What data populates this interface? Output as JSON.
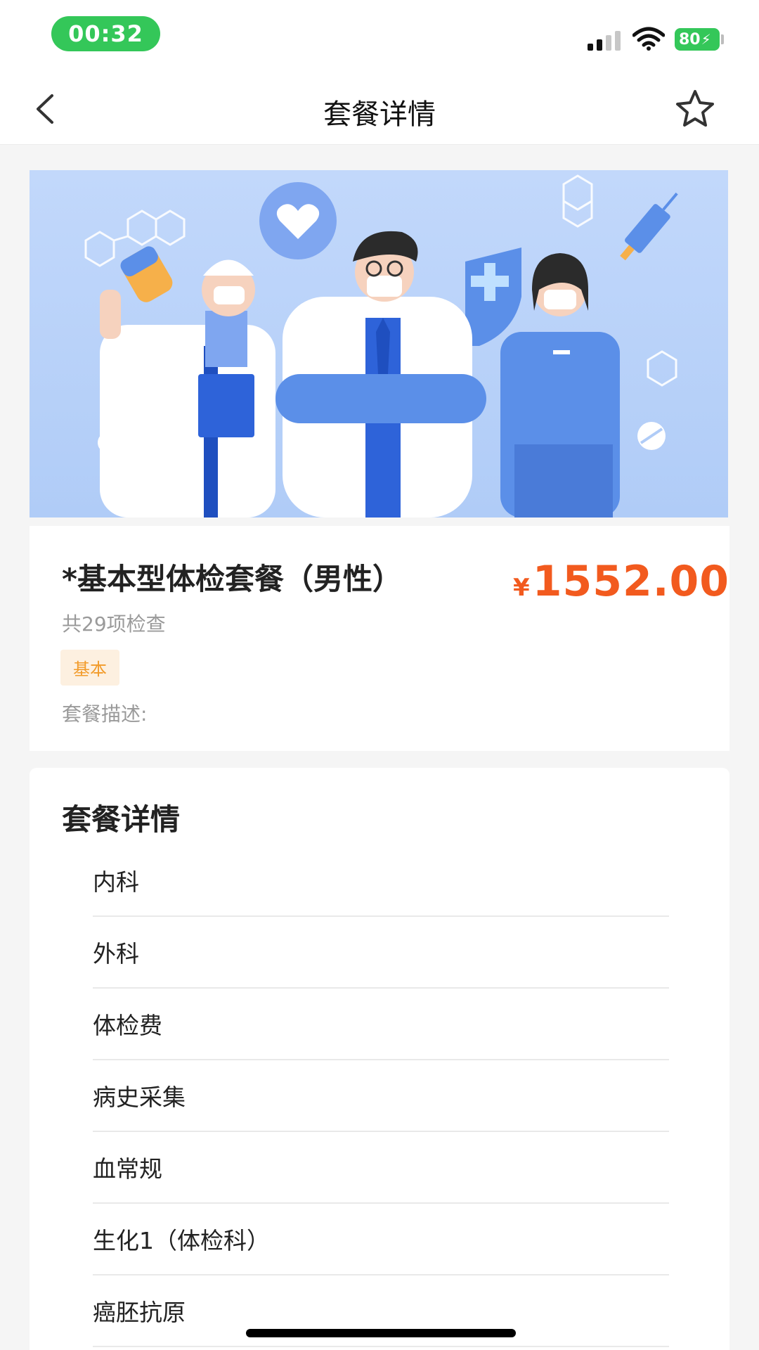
{
  "status_bar": {
    "time": "00:32",
    "battery_level": "80",
    "signal_icon": "signal-icon",
    "wifi_icon": "wifi-icon",
    "battery_icon": "battery-charging-icon",
    "accent_color": "#34c759"
  },
  "nav": {
    "title": "套餐详情",
    "back_icon": "chevron-left-icon",
    "favorite_icon": "star-outline-icon"
  },
  "banner": {
    "image_description_icon": "doctors-illustration",
    "background_color": "#b8d1f8"
  },
  "package": {
    "title": "*基本型体检套餐（男性）",
    "price_symbol": "¥",
    "price": "1552.00",
    "price_color": "#f25a1e",
    "item_count_text": "共29项检查",
    "tag": "基本",
    "description_label": "套餐描述:"
  },
  "details": {
    "title": "套餐详情",
    "items": [
      "内科",
      "外科",
      "体检费",
      "病史采集",
      "血常规",
      "生化1（体检科）",
      "癌胚抗原"
    ]
  }
}
